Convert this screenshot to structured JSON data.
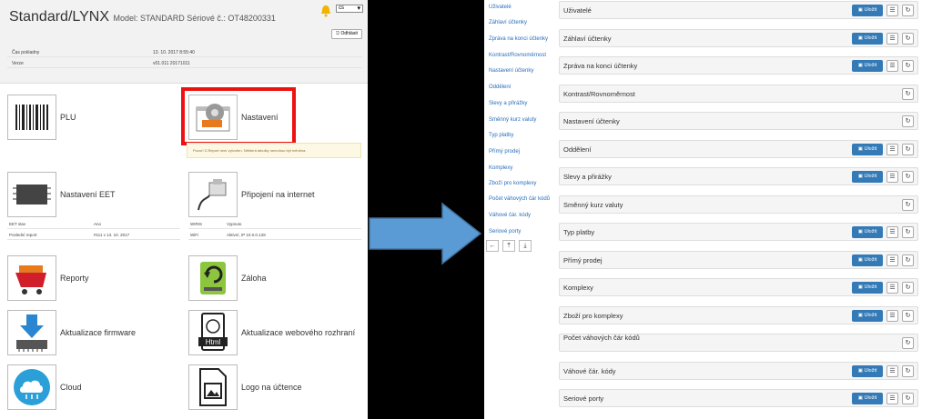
{
  "left": {
    "brand": "Standard/LYNX",
    "model": "Model: STANDARD Sériové č.: OT48200331",
    "language": "cs",
    "logout_label": "Odhlásit",
    "info": [
      {
        "k": "Čas pokladny",
        "v": "13. 10. 2017 8:55:40"
      },
      {
        "k": "Verze",
        "v": "v01.011 20171011"
      }
    ],
    "tiles": {
      "plu": "PLU",
      "settings": "Nastavení",
      "eet": "Nastavení EET",
      "internet": "Připojení na internet",
      "reports": "Reporty",
      "backup": "Záloha",
      "firmware": "Aktualizace firmware",
      "web": "Aktualizace webového rozhraní",
      "cloud": "Cloud",
      "logo": "Logo na účtence"
    },
    "warning": "Pozor! Z-Report není vytvořen. Některá tabulky nemohou být měněna.",
    "eet_info": [
      {
        "k": "EET stav",
        "v": "Ano"
      },
      {
        "k": "Poslední report",
        "v": "#111 v 13. 10. 2017"
      }
    ],
    "net_info": [
      {
        "k": "WIRIS",
        "v": "Vypnuto"
      },
      {
        "k": "WiFi",
        "v": "Aktivní, IP 10.0.0.128"
      }
    ]
  },
  "right": {
    "nav": [
      "Uživatelé",
      "Záhlaví účtenky",
      "Zpráva na konci účtenky",
      "Kontrast/Rovnoměrnost",
      "Nastavení účtenky",
      "Oddělení",
      "Slevy a přirážky",
      "Směnný kurz valuty",
      "Typ platby",
      "Přímý prodej",
      "Komplexy",
      "Zboží pro komplexy",
      "Počet váhových čár kódů",
      "Váhové čár. kódy",
      "Seriové porty"
    ],
    "nav_buttons": [
      "←",
      "⤒",
      "⤓"
    ],
    "save_label": "Uložit",
    "rows": [
      {
        "label": "Uživatelé",
        "full": true
      },
      {
        "label": "Záhlaví účtenky",
        "full": true
      },
      {
        "label": "Zpráva na konci účtenky",
        "full": true
      },
      {
        "label": "Kontrast/Rovnoměrnost",
        "full": false
      },
      {
        "label": "Nastavení účtenky",
        "full": false
      },
      {
        "label": "Oddělení",
        "full": true
      },
      {
        "label": "Slevy a přirážky",
        "full": true
      },
      {
        "label": "Směnný kurz valuty",
        "full": false
      },
      {
        "label": "Typ platby",
        "full": true
      },
      {
        "label": "Přímý prodej",
        "full": true
      },
      {
        "label": "Komplexy",
        "full": true
      },
      {
        "label": "Zboží pro komplexy",
        "full": true
      },
      {
        "label": "Počet váhových čár kódů",
        "full": false
      },
      {
        "label": "Váhové čár. kódy",
        "full": true
      },
      {
        "label": "Seriové porty",
        "full": true
      }
    ]
  },
  "colors": {
    "accent": "#337ab7",
    "highlight": "#ee1111",
    "arrow": "#5b9bd5"
  }
}
